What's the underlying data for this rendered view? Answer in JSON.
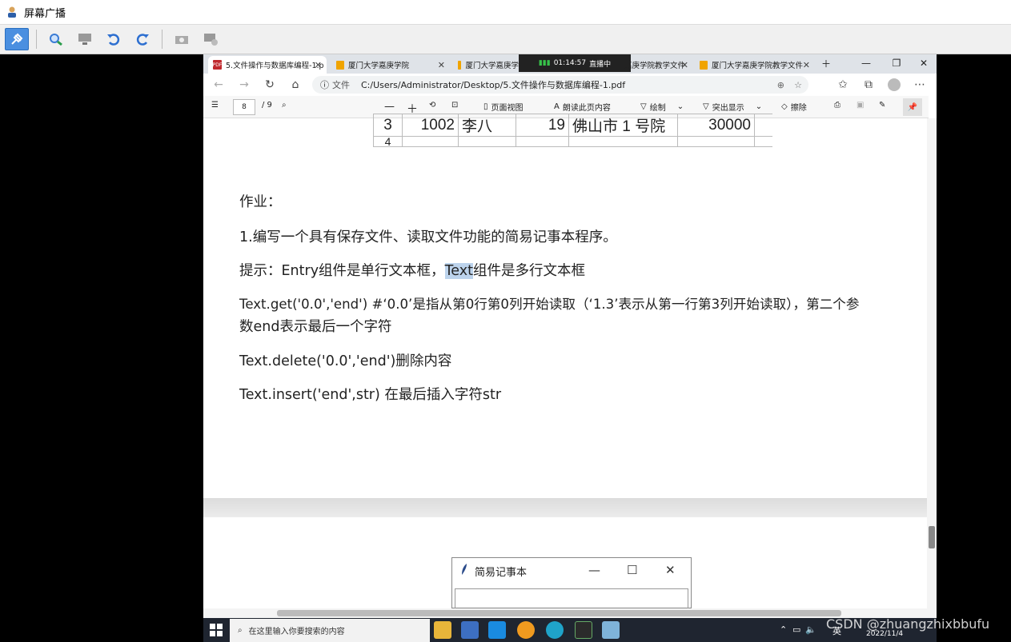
{
  "outer_window": {
    "title": "屏幕广播"
  },
  "browser": {
    "tabs": [
      {
        "label": "5.文件操作与数据库编程-1.p"
      },
      {
        "label": "厦门大学嘉庚学院"
      },
      {
        "label": "厦门大学嘉庚学"
      },
      {
        "label": "嘉庚学院教学文件"
      },
      {
        "label": "厦门大学嘉庚学院教学文件"
      }
    ],
    "live": {
      "time": "01:14:57",
      "status": "直播中"
    },
    "address": {
      "label": "文件",
      "url": "C:/Users/Administrator/Desktop/5.文件操作与数据库编程-1.pdf"
    }
  },
  "pdf_toolbar": {
    "page_current": "8",
    "page_total": "/ 9",
    "page_view": "页面视图",
    "read_aloud": "朗读此页内容",
    "draw": "绘制",
    "highlight": "突出显示",
    "erase": "擦除"
  },
  "table_row": {
    "c1": "3",
    "c2": "1002",
    "c3": "李八",
    "c4": "19",
    "c5": "佛山市 1 号院",
    "c6": "30000",
    "next_row": "4"
  },
  "content": {
    "heading": "作业：",
    "item1": "1.编写一个具有保存文件、读取文件功能的简易记事本程序。",
    "hint_prefix": "提示：Entry组件是单行文本框，",
    "hint_highlight": "Text",
    "hint_suffix": "组件是多行文本框",
    "get_line1": "Text.get('0.0','end')  #‘0.0’是指从第0行第0列开始读取（‘1.3’表示从第一行第3列开始读取），第二个参",
    "get_line2": "数end表示最后一个字符",
    "delete_line": "Text.delete('0.0','end')删除内容",
    "insert_line": "Text.insert('end',str) 在最后插入字符str"
  },
  "notepad": {
    "title": "简易记事本"
  },
  "taskbar": {
    "search_placeholder": "在这里输入你要搜索的内容",
    "ime": "英",
    "date": "2022/11/4"
  },
  "watermark": "CSDN @zhuangzhixbbufu",
  "colors": {
    "highlight": "#bcd3ec",
    "taskbar": "#1f2530",
    "active_tool": "#4a8fe0"
  }
}
